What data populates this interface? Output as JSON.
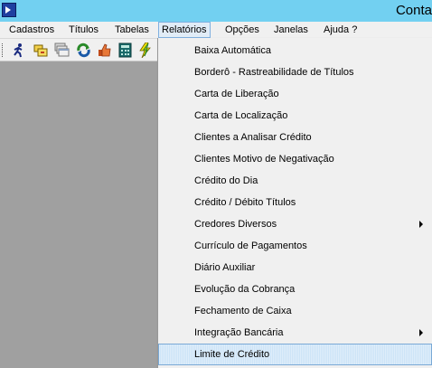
{
  "window": {
    "title": "Conta"
  },
  "menubar": {
    "items": [
      {
        "label": "Cadastros"
      },
      {
        "label": "Títulos"
      },
      {
        "label": "Tabelas"
      },
      {
        "label": "Relatórios"
      },
      {
        "label": "Opções"
      },
      {
        "label": "Janelas"
      },
      {
        "label": "Ajuda ?"
      }
    ],
    "active": "Relatórios"
  },
  "toolbar": {
    "buttons": [
      {
        "icon": "running-man-icon"
      },
      {
        "icon": "folders-icon"
      },
      {
        "icon": "window-stack-icon"
      },
      {
        "icon": "recycle-icon"
      },
      {
        "icon": "thumbs-up-icon"
      },
      {
        "icon": "calculator-icon"
      },
      {
        "icon": "lightning-icon"
      }
    ]
  },
  "relatorios_menu": {
    "items": [
      {
        "label": "Baixa Automática",
        "has_submenu": false
      },
      {
        "label": "Borderô - Rastreabilidade de Títulos",
        "has_submenu": false
      },
      {
        "label": "Carta de Liberação",
        "has_submenu": false
      },
      {
        "label": "Carta de Localização",
        "has_submenu": false
      },
      {
        "label": "Clientes a Analisar Crédito",
        "has_submenu": false
      },
      {
        "label": "Clientes Motivo de Negativação",
        "has_submenu": false
      },
      {
        "label": "Crédito do Dia",
        "has_submenu": false
      },
      {
        "label": "Crédito / Débito Títulos",
        "has_submenu": false
      },
      {
        "label": "Credores Diversos",
        "has_submenu": true
      },
      {
        "label": "Currículo de Pagamentos",
        "has_submenu": false
      },
      {
        "label": "Diário Auxiliar",
        "has_submenu": false
      },
      {
        "label": "Evolução da Cobrança",
        "has_submenu": false
      },
      {
        "label": "Fechamento de Caixa",
        "has_submenu": false
      },
      {
        "label": "Integração Bancária",
        "has_submenu": true
      },
      {
        "label": "Limite de Crédito",
        "has_submenu": false,
        "highlighted": true
      }
    ]
  },
  "colors": {
    "titlebar": "#72d0f1",
    "menu_background": "#f0f0f0",
    "highlight": "#cde4f7",
    "client_area": "#a0a0a0"
  }
}
